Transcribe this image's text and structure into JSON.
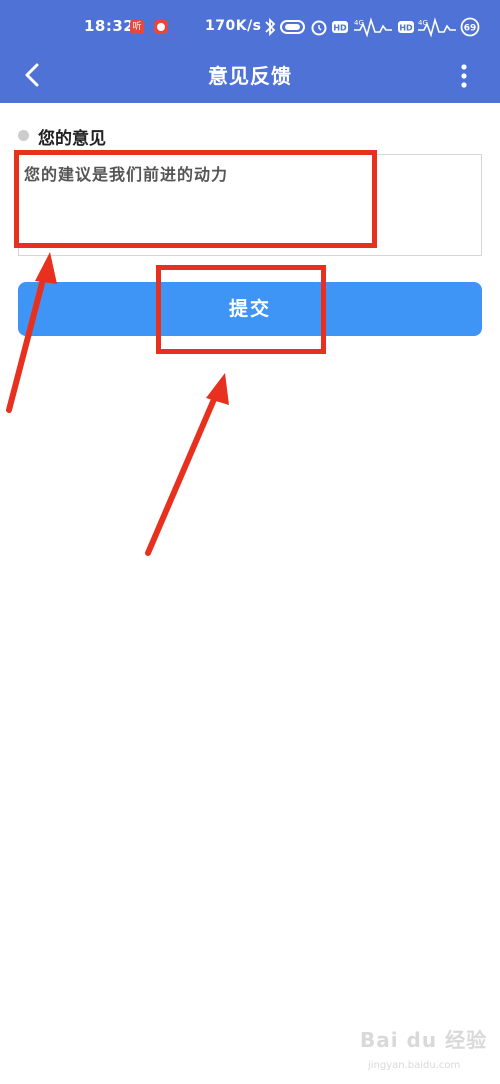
{
  "status_bar": {
    "time": "18:32",
    "notification_badge": "听",
    "network_speed": "170K/s",
    "icons": [
      "bluetooth-icon",
      "battery-saver-icon",
      "alarm-icon",
      "hd-icon",
      "signal-4g-icon",
      "hd-icon",
      "signal-4g-icon",
      "battery-icon"
    ],
    "battery_level": "69"
  },
  "app_bar": {
    "title": "意见反馈",
    "back_icon": "chevron-left-icon",
    "more_icon": "more-vertical-icon"
  },
  "form": {
    "label": "您的意见",
    "placeholder": "您的建议是我们前进的动力",
    "submit_label": "提交"
  },
  "colors": {
    "header": "#4f72d6",
    "submit_button": "#3f95f6",
    "annotation": "#e8301e"
  },
  "watermark": {
    "logo": "Bai du 经验",
    "url": "jingyan.baidu.com"
  }
}
